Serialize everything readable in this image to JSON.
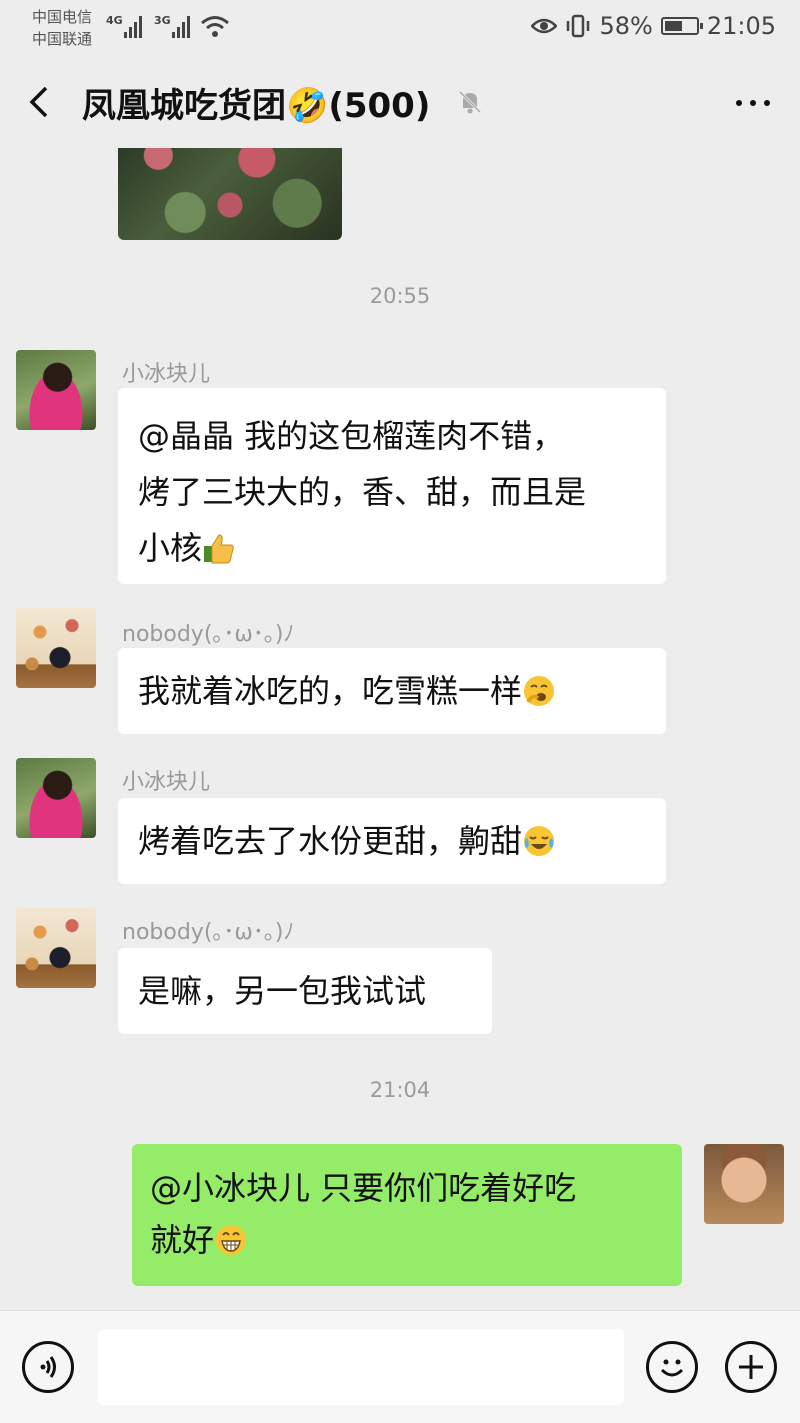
{
  "status_bar": {
    "carrier1": "中国电信",
    "carrier2": "中国联通",
    "net1": "4G",
    "net2": "3G",
    "battery_text": "58%",
    "battery_level": 0.58,
    "time": "21:05"
  },
  "header": {
    "title": "凤凰城吃货团🤣(500)"
  },
  "messages": [
    {
      "time": "20:55"
    },
    {
      "sender": "小冰块儿",
      "lines": [
        "@晶晶  我的这包榴莲肉不错，",
        "烤了三块大的，香、甜，而且是",
        "小核"
      ],
      "emoji": "thumbs-up"
    },
    {
      "sender": "nobody(｡･ω･｡)ﾉ",
      "text": "我就着冰吃的，吃雪糕一样",
      "emoji": "yawn"
    },
    {
      "sender": "小冰块儿",
      "text": "烤着吃去了水份更甜，齁甜",
      "emoji": "tears-of-joy"
    },
    {
      "sender": "nobody(｡･ω･｡)ﾉ",
      "text": "是嘛，另一包我试试"
    },
    {
      "time": "21:04"
    },
    {
      "me": true,
      "lines": [
        "@小冰块儿  只要你们吃着好吃",
        "就好"
      ],
      "emoji": "grin"
    }
  ],
  "colors": {
    "background": "#ededed",
    "my_bubble": "#95ec69",
    "other_bubble": "#ffffff"
  }
}
